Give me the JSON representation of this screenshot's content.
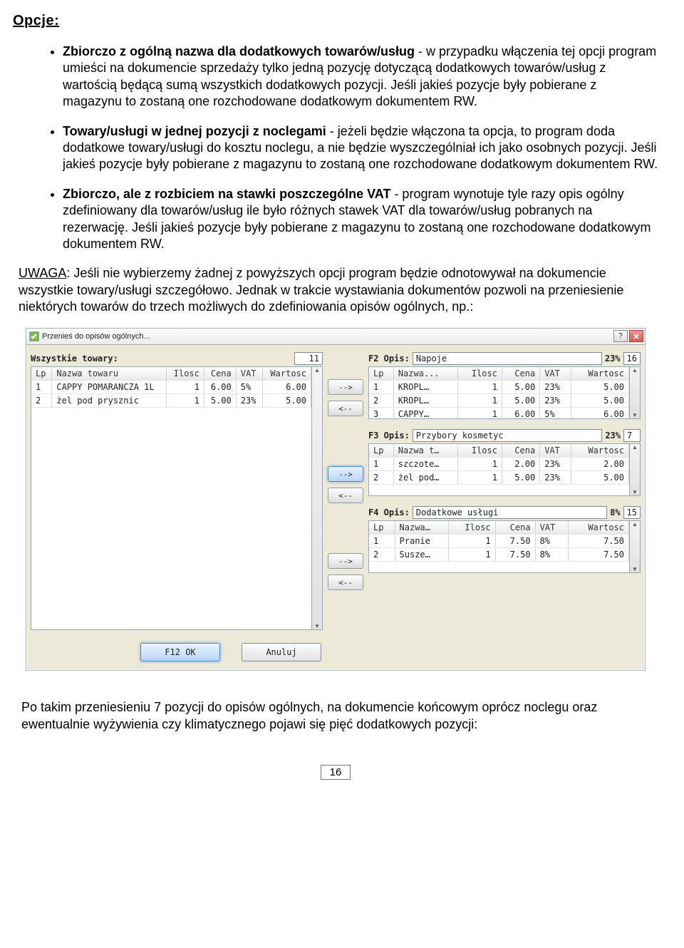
{
  "heading": "Opcje:",
  "bullets": [
    {
      "lead": "Zbiorczo z ogólną nazwa dla dodatkowych towarów/usług",
      "rest": " - w przypadku włączenia tej opcji program umieści na dokumencie sprzedaży tylko jedną pozycję dotyczącą dodatkowych towarów/usług z wartością będącą sumą wszystkich dodatkowych pozycji. Jeśli jakieś pozycje były pobierane z magazynu to zostaną one rozchodowane dodatkowym dokumentem RW."
    },
    {
      "lead": "Towary/usługi w jednej pozycji z noclegami",
      "rest": " - jeżeli będzie włączona ta opcja, to program doda dodatkowe towary/usługi do kosztu noclegu, a nie będzie wyszczególniał ich jako osobnych pozycji. Jeśli jakieś pozycje były pobierane z magazynu to zostaną one rozchodowane dodatkowym dokumentem RW."
    },
    {
      "lead": "Zbiorczo, ale z rozbiciem na stawki poszczególne VAT",
      "rest": " - program wynotuje tyle razy opis ogólny zdefiniowany dla towarów/usług ile było różnych stawek VAT dla towarów/usług pobranych na rezerwację. Jeśli jakieś pozycje były pobierane z magazynu to zostaną one rozchodowane dodatkowym dokumentem RW."
    }
  ],
  "uwaga_lead": "UWAGA",
  "uwaga_rest": ": Jeśli nie wybierzemy żadnej z powyższych opcji program będzie odnotowywał na dokumencie wszystkie towary/usługi szczegółowo. Jednak w trakcie wystawiania dokumentów pozwoli na przeniesienie niektórych towarów do trzech możliwych do zdefiniowania opisów ogólnych, np.:",
  "dialog": {
    "title": "Przenieś do opisów ogólnych...",
    "left_label": "Wszystkie towary:",
    "left_count": "11",
    "left_cols": [
      "Lp",
      "Nazwa towaru",
      "Ilosc",
      "Cena",
      "VAT",
      "Wartosc"
    ],
    "left_rows": [
      [
        "1",
        "CAPPY POMARANCZA 1L",
        "1",
        "6.00",
        "5%",
        "6.00"
      ],
      [
        "2",
        "żel pod prysznic",
        "1",
        "5.00",
        "23%",
        "5.00"
      ]
    ],
    "arrows": {
      "right": "-->",
      "left": "<--"
    },
    "groups": [
      {
        "label": "F2 Opis:",
        "name": "Napoje",
        "vat": "23%",
        "count": "16",
        "cols": [
          "Lp",
          "Nazwa...",
          "Ilosc",
          "Cena",
          "VAT",
          "Wartosc"
        ],
        "rows": [
          [
            "1",
            "KROPL…",
            "1",
            "5.00",
            "23%",
            "5.00"
          ],
          [
            "2",
            "KROPL…",
            "1",
            "5.00",
            "23%",
            "5.00"
          ],
          [
            "3",
            "CAPPY…",
            "1",
            "6.00",
            "5%",
            "6.00"
          ]
        ]
      },
      {
        "label": "F3 Opis:",
        "name": "Przybory kosmetyc",
        "vat": "23%",
        "count": "7",
        "cols": [
          "Lp",
          "Nazwa t…",
          "Ilosc",
          "Cena",
          "VAT",
          "Wartosc"
        ],
        "rows": [
          [
            "1",
            "szczote…",
            "1",
            "2.00",
            "23%",
            "2.00"
          ],
          [
            "2",
            "żel pod…",
            "1",
            "5.00",
            "23%",
            "5.00"
          ]
        ]
      },
      {
        "label": "F4 Opis:",
        "name": "Dodatkowe usługi",
        "vat": "8%",
        "count": "15",
        "cols": [
          "Lp",
          "Nazwa…",
          "Ilosc",
          "Cena",
          "VAT",
          "Wartosc"
        ],
        "rows": [
          [
            "1",
            "Pranie",
            "1",
            "7.50",
            "8%",
            "7.50"
          ],
          [
            "2",
            "Susze…",
            "1",
            "7.50",
            "8%",
            "7.50"
          ]
        ]
      }
    ],
    "ok_btn": "F12 OK",
    "cancel_btn": "Anuluj"
  },
  "after": "Po takim przeniesieniu 7 pozycji do opisów ogólnych, na dokumencie końcowym oprócz noclegu oraz ewentualnie wyżywienia czy klimatycznego pojawi się pięć dodatkowych pozycji:",
  "pagenum": "16"
}
